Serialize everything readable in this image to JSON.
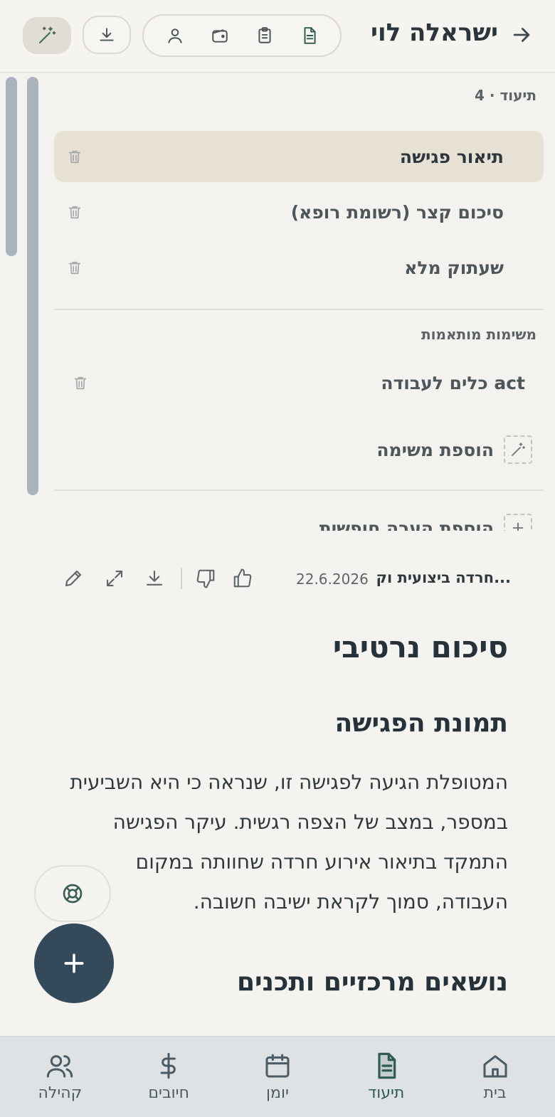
{
  "header": {
    "patient_name": "ישראלה לוי",
    "icons": [
      "back-arrow-icon",
      "file-text-icon",
      "clipboard-list-icon",
      "wallet-icon",
      "user-icon",
      "download-icon",
      "magic-wand-icon"
    ]
  },
  "docs": {
    "section_title": "תיעוד · 4",
    "items": [
      {
        "label": "תיאור פגישה",
        "active": true
      },
      {
        "label": "סיכום קצר (רשומת רופא)",
        "active": false
      },
      {
        "label": "שעתוק מלא",
        "active": false
      }
    ],
    "tasks_title": "משימות מותאמות",
    "tasks": [
      {
        "label": "כלים לעבודה act"
      }
    ],
    "add_task_label": "הוספת משימה",
    "add_note_label": "הוספת הערה חופשית"
  },
  "card": {
    "title": "חרדה ביצועית וק...",
    "date": "22.6.2026",
    "heading": "סיכום נרטיבי",
    "section1_title": "תמונת הפגישה",
    "section1_text": "המטופלת הגיעה לפגישה זו, שנראה כי היא השביעית במספר, במצב של הצפה רגשית. עיקר הפגישה התמקד בתיאור אירוע חרדה שחוותה במקום העבודה, סמוך לקראת ישיבה חשובה.",
    "section2_title": "נושאים מרכזיים ותכנים"
  },
  "nav": {
    "items": [
      {
        "label": "בית",
        "icon": "home-icon",
        "active": false
      },
      {
        "label": "תיעוד",
        "icon": "document-icon",
        "active": true
      },
      {
        "label": "יומן",
        "icon": "calendar-icon",
        "active": false
      },
      {
        "label": "חיובים",
        "icon": "dollar-icon",
        "active": false
      },
      {
        "label": "קהילה",
        "icon": "users-icon",
        "active": false
      }
    ]
  },
  "colors": {
    "background": "#f4f2ee",
    "active_item": "#e7e0d5",
    "fab": "#34495a",
    "nav_active": "#2f5a4e",
    "nav_bar": "#dfe2e4"
  }
}
